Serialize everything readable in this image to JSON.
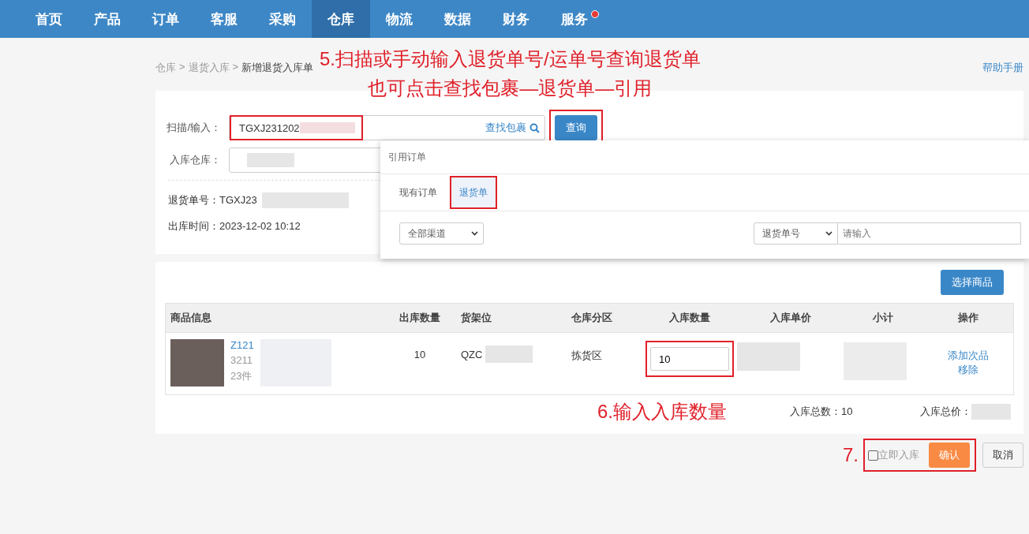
{
  "nav": [
    {
      "label": "首页",
      "selected": false,
      "badge": false
    },
    {
      "label": "产品",
      "selected": false,
      "badge": false
    },
    {
      "label": "订单",
      "selected": false,
      "badge": false
    },
    {
      "label": "客服",
      "selected": false,
      "badge": false
    },
    {
      "label": "采购",
      "selected": false,
      "badge": false
    },
    {
      "label": "仓库",
      "selected": true,
      "badge": false
    },
    {
      "label": "物流",
      "selected": false,
      "badge": false
    },
    {
      "label": "数据",
      "selected": false,
      "badge": false
    },
    {
      "label": "财务",
      "selected": false,
      "badge": false
    },
    {
      "label": "服务",
      "selected": false,
      "badge": true
    }
  ],
  "breadcrumb": {
    "items": [
      "仓库",
      "退货入库",
      "新增退货入库单"
    ],
    "separators": [
      ">",
      ">"
    ]
  },
  "annotations": [
    "5.扫描或手动输入退货单号/运单号查询退货单",
    "也可点击查找包裹—退货单—引用"
  ],
  "help_link": "帮助手册",
  "form": {
    "scan_label": "扫描/输入：",
    "scan_value": "TGXJ231202",
    "scan_highlighted": true,
    "find_link": "查找包裹",
    "query_button": "查询",
    "query_highlighted": true,
    "warehouse_label": "入库仓库：",
    "return_no_label": "退货单号：",
    "return_no_value": "TGXJ23",
    "ship_time_label": "出库时间：",
    "ship_time_value": "2023-12-02 10:12"
  },
  "popup": {
    "title": "引用订单",
    "tabs": [
      {
        "label": "现有订单",
        "selected": false,
        "highlighted": false
      },
      {
        "label": "退货单",
        "selected": true,
        "highlighted": true
      }
    ],
    "channel_select": "全部渠道",
    "search_type": "退货单号",
    "search_placeholder": "请输入"
  },
  "products": {
    "select_button": "选择商品",
    "columns": [
      "商品信息",
      "出库数量",
      "货架位",
      "仓库分区",
      "入库数量",
      "入库单价",
      "小计",
      "操作"
    ],
    "rows": [
      {
        "sku": "Z121",
        "code": "3211",
        "count": "23件",
        "out_qty": "10",
        "shelf": "QZC",
        "zone": "拣货区",
        "in_qty": "10",
        "in_qty_highlighted": true,
        "actions": [
          "添加次品",
          "移除"
        ]
      }
    ],
    "note": "6.输入入库数量",
    "total_qty_label": "入库总数：",
    "total_qty": "10",
    "total_price_label": "入库总价："
  },
  "footer": {
    "step": "7.",
    "highlighted": true,
    "instant_label": "立即入库",
    "instant_checked": false,
    "confirm": "确认",
    "cancel": "取消"
  }
}
